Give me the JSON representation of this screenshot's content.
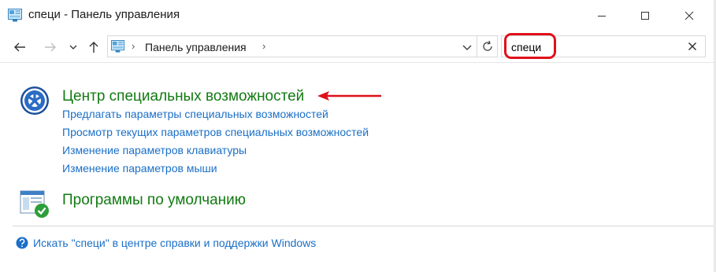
{
  "window": {
    "title": "специ - Панель управления",
    "icon": "control-panel-icon"
  },
  "nav": {
    "back_icon": "arrow-left-icon",
    "forward_icon": "arrow-right-icon",
    "recent_icon": "chevron-down-icon",
    "up_icon": "arrow-up-icon"
  },
  "address": {
    "path_label": "Панель управления",
    "separator": "›"
  },
  "search": {
    "value": "специ"
  },
  "results": [
    {
      "title": "Центр специальных возможностей",
      "icon": "accessibility-center-icon",
      "links": [
        "Предлагать параметры специальных возможностей",
        "Просмотр текущих параметров специальных возможностей",
        "Изменение параметров клавиатуры",
        "Изменение параметров мыши"
      ]
    },
    {
      "title": "Программы по умолчанию",
      "icon": "default-programs-icon",
      "links": []
    }
  ],
  "help": {
    "label": "Искать \"специ\" в центре справки и поддержки Windows",
    "icon": "help-question-icon"
  },
  "colors": {
    "group_title": "#127a12",
    "link": "#1a6fc7",
    "annotation": "#e0101a"
  }
}
